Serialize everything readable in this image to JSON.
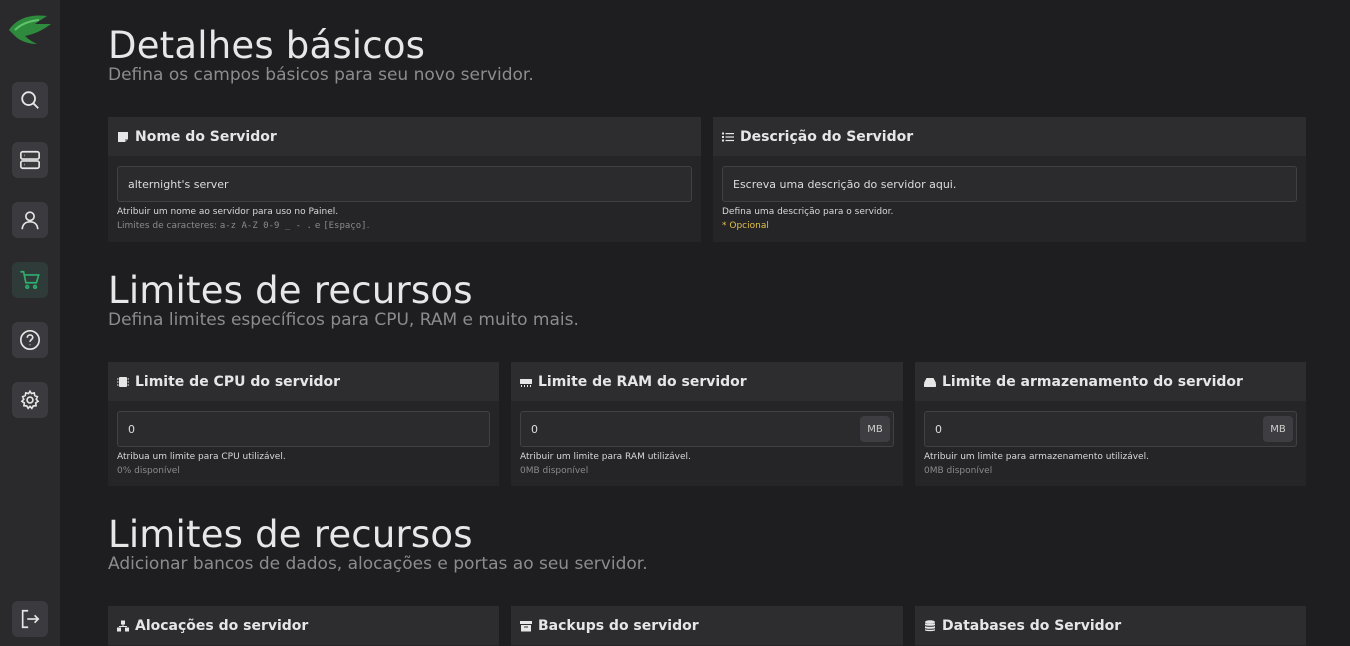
{
  "nav": {
    "items": [
      {
        "name": "search-icon"
      },
      {
        "name": "servers-icon"
      },
      {
        "name": "user-icon"
      },
      {
        "name": "cart-icon"
      },
      {
        "name": "help-icon"
      },
      {
        "name": "settings-icon"
      },
      {
        "name": "logout-icon"
      }
    ],
    "accent": "#2fae6e"
  },
  "basic": {
    "title": "Detalhes básicos",
    "subtitle": "Defina os campos básicos para seu novo servidor.",
    "name_card": {
      "title": "Nome do Servidor",
      "value": "alternight's server",
      "help": "Atribuir um nome ao servidor para uso no Painel.",
      "limits_prefix": "Limites de caracteres: ",
      "limits_chars": "a-z A-Z 0-9 _ - .",
      "limits_and": " e ",
      "limits_space": "[Espaço]",
      "limits_end": "."
    },
    "desc_card": {
      "title": "Descrição do Servidor",
      "placeholder": "Escreva uma descrição do servidor aqui.",
      "help": "Defina uma descrição para o servidor.",
      "optional": "* Opcional"
    }
  },
  "resources": {
    "title": "Limites de recursos",
    "subtitle": "Defina limites específicos para CPU, RAM e muito mais.",
    "cpu": {
      "title": "Limite de CPU do servidor",
      "value": "0",
      "help": "Atribua um limite para CPU utilizável.",
      "available": "0% disponível"
    },
    "ram": {
      "title": "Limite de RAM do servidor",
      "value": "0",
      "suffix": "MB",
      "help": "Atribuir um limite para RAM utilizável.",
      "available": "0MB disponível"
    },
    "storage": {
      "title": "Limite de armazenamento do servidor",
      "value": "0",
      "suffix": "MB",
      "help": "Atribuir um limite para armazenamento utilizável.",
      "available": "0MB disponível"
    }
  },
  "features": {
    "title": "Limites de recursos",
    "subtitle": "Adicionar bancos de dados, alocações e portas ao seu servidor.",
    "allocations": {
      "title": "Alocações do servidor"
    },
    "backups": {
      "title": "Backups do servidor"
    },
    "databases": {
      "title": "Databases do Servidor"
    }
  }
}
